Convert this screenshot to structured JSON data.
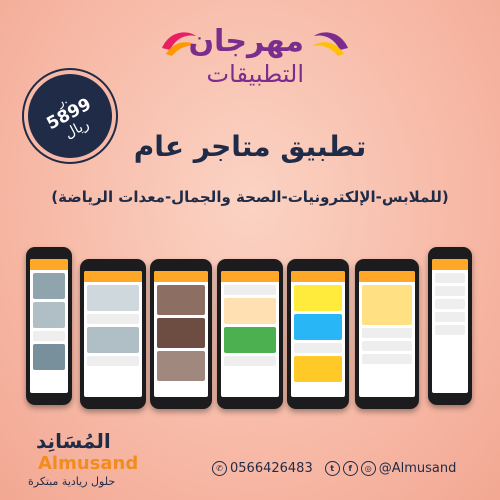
{
  "logo": {
    "line1": "مهرجان",
    "line2": "التطبيقات"
  },
  "price": {
    "amount": "5899",
    "currency_top": "ر.",
    "currency": "ريال"
  },
  "title": "تطبيق متاجر عام",
  "subtitle": "(للملابس-الإلكترونيات-الصحة والجمال-معدات الرياضة)",
  "brand": {
    "arabic": "المُسَانِد",
    "english": "Almusand",
    "tagline": "حلول ريادية مبتكرة"
  },
  "contact": {
    "phone": "0566426483",
    "handle": "@Almusand"
  },
  "colors": {
    "navy": "#1f2b47",
    "orange": "#f28c1e",
    "purple": "#7a2d8c",
    "accent": "#ffa726"
  },
  "phones": [
    {
      "screen": "store-home"
    },
    {
      "screen": "categories"
    },
    {
      "screen": "shop-list"
    },
    {
      "screen": "product-shop"
    },
    {
      "screen": "product-grid"
    },
    {
      "screen": "product-detail"
    },
    {
      "screen": "profile"
    }
  ]
}
